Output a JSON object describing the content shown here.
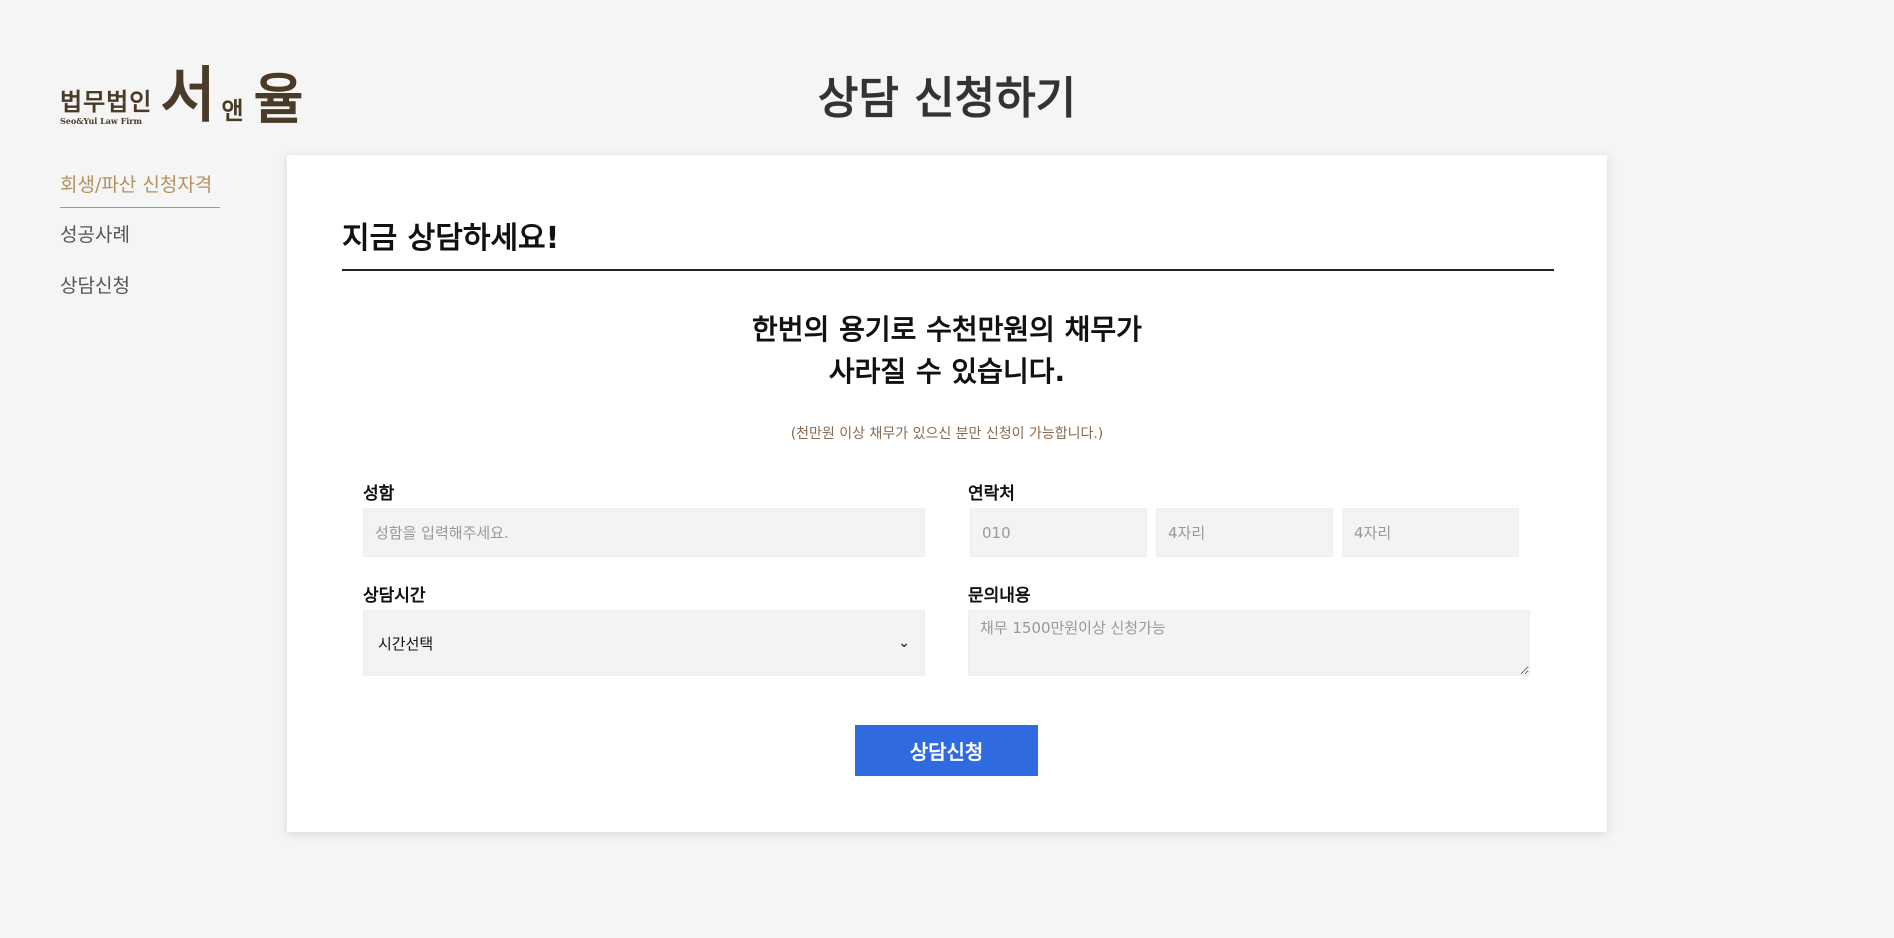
{
  "logo": {
    "firm": "법무법인",
    "english": "Seo&Yul Law Firm",
    "seo": "서",
    "and": "앤",
    "yul": "율"
  },
  "nav": {
    "items": [
      {
        "label": "회생/파산 신청자격"
      },
      {
        "label": "성공사례"
      },
      {
        "label": "상담신청"
      }
    ]
  },
  "page": {
    "title": "상담 신청하기"
  },
  "form": {
    "heading": "지금 상담하세요!",
    "lead_line1": "한번의 용기로 수천만원의 채무가",
    "lead_line2": "사라질 수 있습니다.",
    "note": "(천만원 이상 채무가 있으신 분만 신청이 가능합니다.)",
    "name": {
      "label": "성함",
      "placeholder": "성함을 입력해주세요."
    },
    "contact": {
      "label": "연락처",
      "placeholders": [
        "010",
        "4자리",
        "4자리"
      ]
    },
    "time": {
      "label": "상담시간",
      "selected": "시간선택"
    },
    "inquiry": {
      "label": "문의내용",
      "placeholder": "채무 1500만원이상 신청가능"
    },
    "submit_label": "상담신청"
  },
  "colors": {
    "accent": "#b59160",
    "button": "#2f6ae0",
    "background": "#f5f5f5"
  }
}
